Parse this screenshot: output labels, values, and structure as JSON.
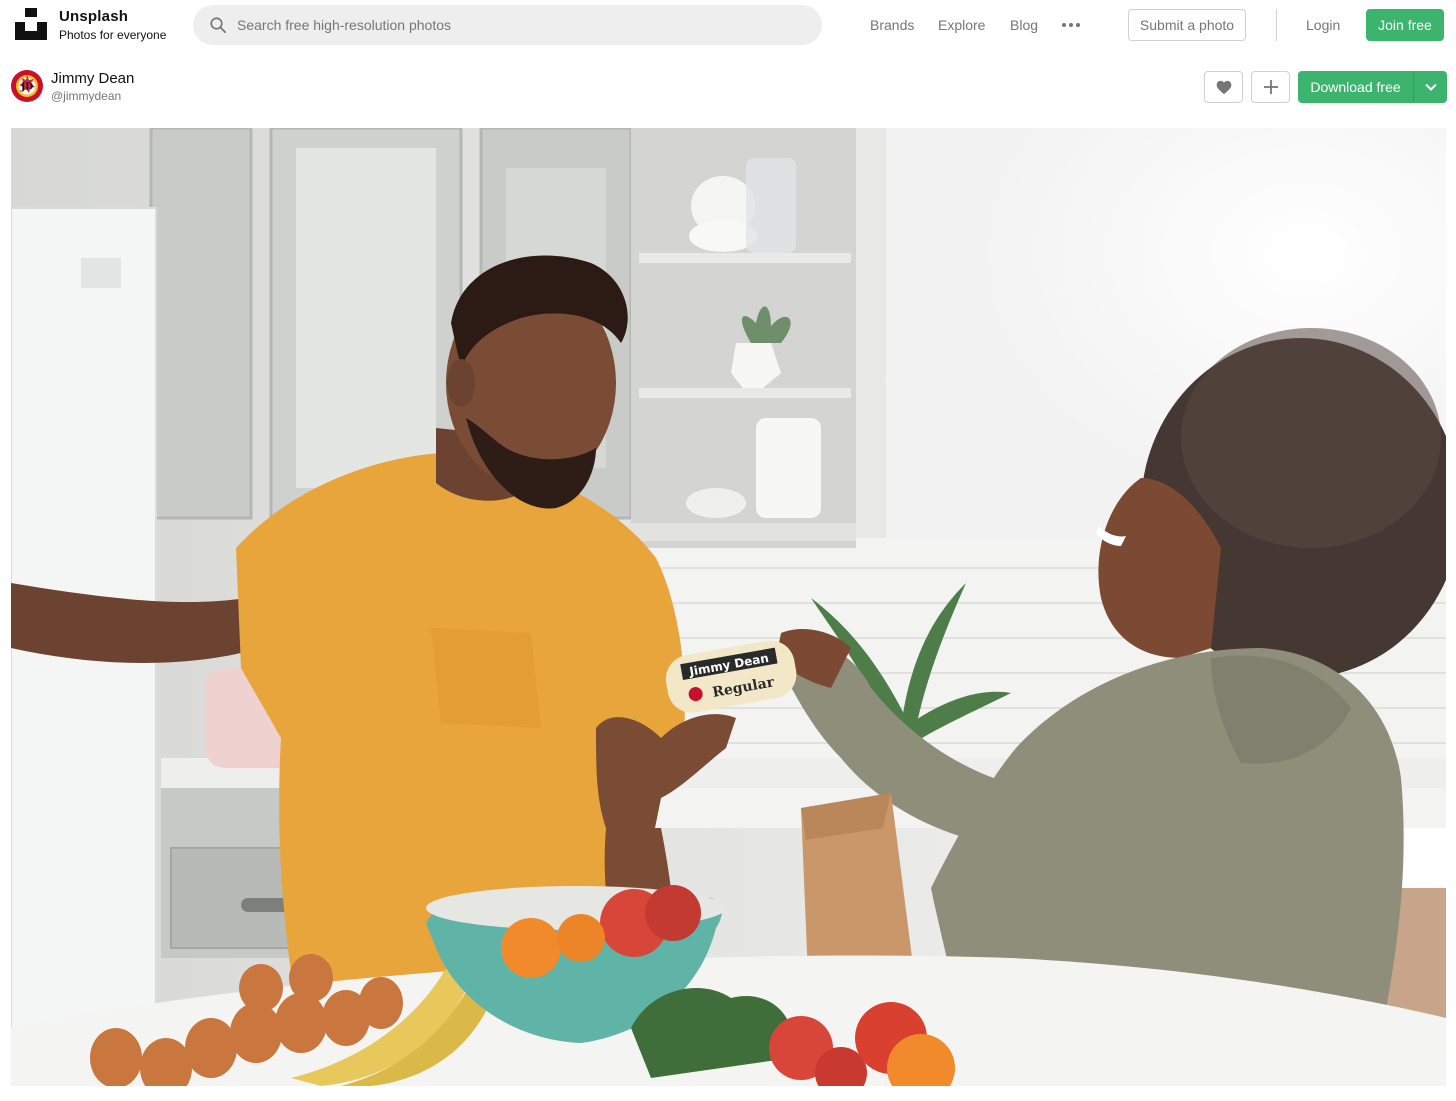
{
  "brand": {
    "name": "Unsplash",
    "tagline": "Photos for everyone",
    "logo_icon": "unsplash-logo-icon"
  },
  "search": {
    "placeholder": "Search free high-resolution photos",
    "value": "",
    "icon": "search-icon"
  },
  "nav": {
    "items": [
      {
        "label": "Brands"
      },
      {
        "label": "Explore"
      },
      {
        "label": "Blog"
      }
    ],
    "more_icon": "more-horizontal-icon",
    "submit_label": "Submit a photo",
    "login_label": "Login",
    "join_label": "Join free"
  },
  "photo_header": {
    "author_name": "Jimmy Dean",
    "author_handle": "@jimmydean",
    "like_icon": "heart-icon",
    "collect_icon": "plus-icon",
    "download_label": "Download free",
    "download_caret_icon": "chevron-down-icon"
  },
  "photo": {
    "product_brand": "Jimmy Dean",
    "product_variety": "Regular"
  },
  "colors": {
    "accent_green": "#3cb46e",
    "text_primary": "#111111",
    "text_secondary": "#767676",
    "border": "#d1d1d1",
    "search_bg": "#eeeeee"
  }
}
